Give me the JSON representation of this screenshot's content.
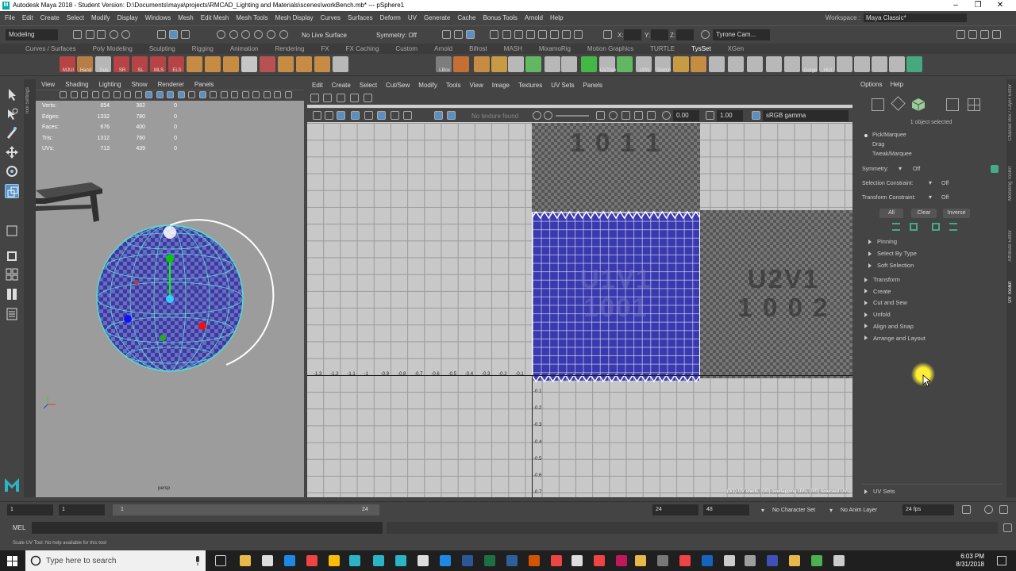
{
  "title": {
    "text": "Autodesk Maya 2018 - Student Version: D:\\Documents\\maya\\projects\\RMCAD_Lighting and Materials\\scenes\\workBench.mb*   ---   pSphere1",
    "minimize": "–",
    "restore": "❐",
    "close": "✕"
  },
  "menubar": {
    "items": [
      "File",
      "Edit",
      "Create",
      "Select",
      "Modify",
      "Display",
      "Windows",
      "Mesh",
      "Edit Mesh",
      "Mesh Tools",
      "Mesh Display",
      "Curves",
      "Surfaces",
      "Deform",
      "UV",
      "Generate",
      "Cache",
      "Bonus Tools",
      "Arnold",
      "Help"
    ],
    "workspace_label": "Workspace :",
    "workspace_value": "Maya Classic*"
  },
  "statusline": {
    "mode": "Modeling",
    "live_surface": "No Live Surface",
    "symmetry": "Symmetry: Off",
    "x_label": "X:",
    "y_label": "Y:",
    "z_label": "Z:",
    "user": "Tyrone Cam..."
  },
  "shelf": {
    "tabs": [
      "Curves / Surfaces",
      "Poly Modeling",
      "Sculpting",
      "Rigging",
      "Animation",
      "Rendering",
      "FX",
      "FX Caching",
      "Custom",
      "Arnold",
      "Bifrost",
      "MASH",
      "MixamoRig",
      "Motion Graphics",
      "TURTLE",
      "TysSet",
      "XGen"
    ],
    "active_tab": "TysSet",
    "icon_labels": [
      "MJUI",
      "Hand",
      "Sub",
      "SR",
      "SL",
      "MLS",
      "ELS",
      "",
      "",
      "",
      "",
      "",
      "",
      "",
      "",
      "",
      "LBox",
      "",
      "",
      "",
      "",
      "",
      "",
      "",
      "",
      "UVTran",
      "",
      "UPN",
      "Sketch",
      "",
      "",
      "",
      "",
      "",
      "",
      "",
      "Gorge",
      "Hist",
      "",
      "",
      "",
      "",
      "",
      "Hist",
      "Hist"
    ]
  },
  "viewport": {
    "menu": [
      "View",
      "Shading",
      "Lighting",
      "Show",
      "Renderer",
      "Panels"
    ],
    "hud": [
      {
        "label": "Verts:",
        "a": "654",
        "b": "382",
        "c": "0"
      },
      {
        "label": "Edges:",
        "a": "1332",
        "b": "780",
        "c": "0"
      },
      {
        "label": "Faces:",
        "a": "676",
        "b": "400",
        "c": "0"
      },
      {
        "label": "Tris:",
        "a": "1312",
        "b": "760",
        "c": "0"
      },
      {
        "label": "UVs:",
        "a": "713",
        "b": "439",
        "c": "0"
      }
    ],
    "camera_label": "persp"
  },
  "uv_editor": {
    "menu": [
      "Edit",
      "Create",
      "Select",
      "Cut/Sew",
      "Modify",
      "Tools",
      "View",
      "Image",
      "Textures",
      "UV Sets",
      "Panels"
    ],
    "texture_status": "No texture found",
    "exposure": "0.00",
    "gamma": "1.00",
    "color_space": "sRGB gamma",
    "tile_1011": "1 0 1 1",
    "tile_1001_line1": "U1V1",
    "tile_1001_line2": "1001",
    "tile_1002_line1": "U2V1",
    "tile_1002_line2": "1 0 0 2",
    "u_axis": [
      "-1.3",
      "-1.2",
      "-1.1",
      "-1",
      "-0.9",
      "-0.8",
      "-0.7",
      "-0.6",
      "-0.5",
      "-0.4",
      "-0.3",
      "-0.2",
      "-0.1"
    ],
    "v_axis": [
      "-0.1",
      "-0.2",
      "-0.3",
      "-0.4",
      "-0.5",
      "-0.6",
      "-0.7"
    ],
    "status": "(0/1) UV shells, (0/0) overlapping UVs, (0/0) reversed UVs"
  },
  "uv_toolkit": {
    "menu": [
      "Options",
      "Help"
    ],
    "selected_info": "1 object selected",
    "pick_modes": [
      "Pick/Marquee",
      "Drag",
      "Tweak/Marquee"
    ],
    "symmetry_label": "Symmetry:",
    "symmetry_value": "Off",
    "selection_constraint_label": "Selection Constraint:",
    "selection_constraint_value": "Off",
    "transform_constraint_label": "Transform Constraint:",
    "transform_constraint_value": "Off",
    "btn_all": "All",
    "btn_clear": "Clear",
    "btn_inverse": "Inverse",
    "subsections": [
      "Pinning",
      "Select By Type",
      "Soft Selection"
    ],
    "sections": [
      "Transform",
      "Create",
      "Cut and Sew",
      "Unfold",
      "Align and Snap",
      "Arrange and Layout"
    ],
    "uv_sets": "UV Sets",
    "side_tabs": [
      "Channel Box / Layer Editor",
      "Modeling Toolkit",
      "Attribute Editor",
      "UV Toolkit"
    ]
  },
  "timeline": {
    "start": "1",
    "current": "1",
    "range_start": "1",
    "range_end": "24",
    "end": "24",
    "anim_end": "48",
    "character_set": "No Character Set",
    "anim_layer": "No Anim Layer",
    "fps": "24 fps"
  },
  "mel": {
    "label": "MEL"
  },
  "helpline": {
    "text": "Scale UV Tool: No help available for this tool"
  },
  "taskbar": {
    "search_placeholder": "Type here to search",
    "time": "6:03 PM",
    "date": "8/31/2018"
  }
}
